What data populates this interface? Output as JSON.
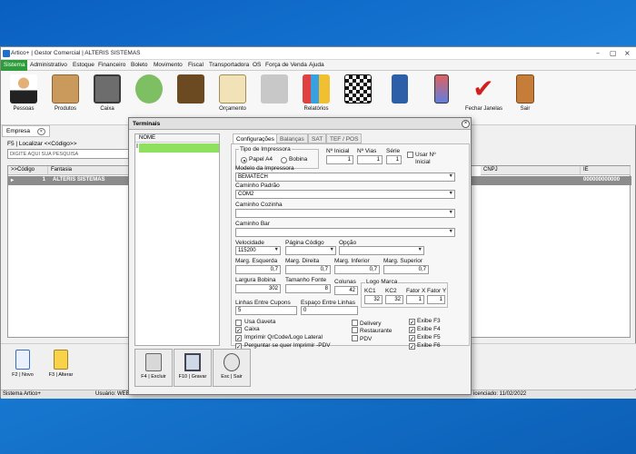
{
  "window": {
    "title": "Artico+ | Gestor Comercial | ALTERIS SISTEMAS"
  },
  "menu": [
    "Sistema",
    "Administrativo",
    "Estoque",
    "Financeiro",
    "Boleto",
    "Movimento",
    "Fiscal",
    "Transportadora",
    "OS",
    "Força de Venda",
    "Ajuda"
  ],
  "toolbar": [
    {
      "label": "Pessoas",
      "icon": "people-icon"
    },
    {
      "label": "Produtos",
      "icon": "box-icon"
    },
    {
      "label": "Caixa",
      "icon": "safe-icon"
    },
    {
      "label": "",
      "icon": "money-icon"
    },
    {
      "label": "",
      "icon": "wallet-icon"
    },
    {
      "label": "Orçamento",
      "icon": "clipboard-icon"
    },
    {
      "label": "",
      "icon": "delivery-icon"
    },
    {
      "label": "Relatórios",
      "icon": "chart-icon"
    },
    {
      "label": "",
      "icon": "qrcode-icon"
    },
    {
      "label": "",
      "icon": "card-machine-icon"
    },
    {
      "label": "",
      "icon": "phone-icon"
    },
    {
      "label": "Fechar Janelas",
      "icon": "checkmark-icon"
    },
    {
      "label": "Sair",
      "icon": "exit-door-icon"
    }
  ],
  "empresa_tab": "Empresa",
  "localizar_label": "F5 | Localizar <<Código>>",
  "search_placeholder": "DIGITE AQUI SUA PESQUISA",
  "grid": {
    "headers": [
      ">>Código",
      "Fantasia",
      "CNPJ",
      "IE"
    ],
    "row": {
      "codigo": "1",
      "fantasia": "ALTERIS SISTEMAS",
      "ie": "000000000000"
    }
  },
  "bottom_buttons": [
    {
      "label": "F2 | Novo"
    },
    {
      "label": "F3 | Alterar"
    }
  ],
  "statusbar": {
    "left": "Sistema Artico+",
    "user": "Usuário: WEB",
    "license": "icenciado: 11/02/2022"
  },
  "dialog": {
    "title": "Terminais",
    "list_header": "NOME",
    "tabs": [
      "Configurações",
      "Balanças",
      "SAT",
      "TEF / POS"
    ],
    "tipo_impressora": "Tipo de Impressora",
    "papel_a4": "Papel A4",
    "bobina": "Bobina",
    "n_inicial_label": "Nº Inicial",
    "n_inicial": "1",
    "n_vias_label": "Nº Vias",
    "n_vias": "1",
    "serie_label": "Série",
    "serie": "1",
    "usar_n_inicial": "Usar Nº Inicial",
    "modelo_label": "Modelo da Impressora",
    "modelo": "BEMATECH",
    "caminho_padrao_label": "Caminho Padrão",
    "caminho_padrao": "COM2",
    "caminho_cozinha_label": "Caminho Cozinha",
    "caminho_bar_label": "Caminho Bar",
    "velocidade_label": "Velocidade",
    "velocidade": "115200",
    "pagina_codigo_label": "Página Código",
    "opcao_label": "Opção",
    "marg_esquerda_label": "Marg. Esquerda",
    "marg_esquerda": "0,7",
    "marg_direita_label": "Marg. Direita",
    "marg_direita": "0,7",
    "marg_inferior_label": "Marg. Inferior",
    "marg_inferior": "0,7",
    "marg_superior_label": "Marg. Superior",
    "marg_superior": "0,7",
    "largura_bobina_label": "Largura Bobina",
    "largura_bobina": "302",
    "tamanho_fonte_label": "Tamanho Fonte",
    "tamanho_fonte": "8",
    "colunas_label": "Colunas",
    "colunas": "42",
    "logo_marca_label": "Logo Marca",
    "kc1_label": "KC1",
    "kc1": "32",
    "kc2_label": "KC2",
    "kc2": "32",
    "fator_x_label": "Fator X",
    "fator_x": "1",
    "fator_y_label": "Fator Y",
    "fator_y": "1",
    "linhas_cupons_label": "Linhas Entre Cupons",
    "linhas_cupons": "5",
    "espaco_linhas_label": "Espaço Entre Linhas",
    "espaco_linhas": "0",
    "checks_left": [
      {
        "label": "Usa Gaveta",
        "checked": false
      },
      {
        "label": "Caixa",
        "checked": true
      },
      {
        "label": "Imprimir QrCode/Logo Lateral",
        "checked": true
      },
      {
        "label": "Perguntar se quer Imprimir -PDV",
        "checked": true
      }
    ],
    "checks_mid": [
      {
        "label": "Delivery",
        "checked": false
      },
      {
        "label": "Restaurante",
        "checked": false
      },
      {
        "label": "PDV",
        "checked": false
      }
    ],
    "checks_right": [
      {
        "label": "Exibe F3",
        "checked": true
      },
      {
        "label": "Exibe F4",
        "checked": true
      },
      {
        "label": "Exibe F5",
        "checked": true
      },
      {
        "label": "Exibe F6",
        "checked": true
      }
    ],
    "buttons": [
      {
        "label": "F4 | Excluir"
      },
      {
        "label": "F10 | Gravar"
      },
      {
        "label": "Esc | Sair"
      }
    ]
  }
}
